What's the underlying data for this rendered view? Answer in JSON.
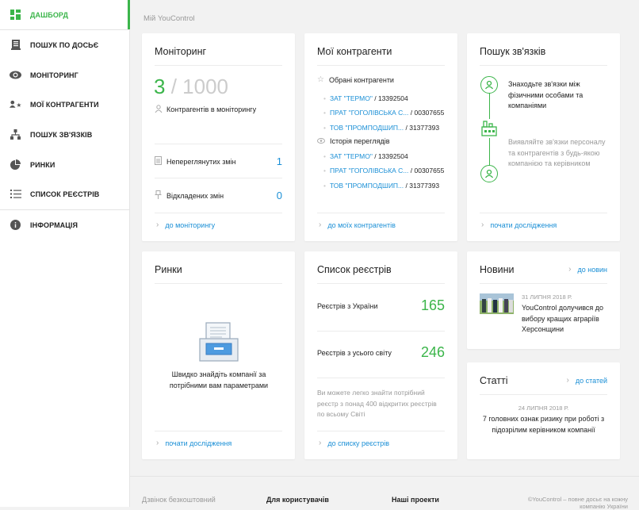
{
  "sidebar": {
    "items": [
      {
        "label": "ДАШБОРД",
        "icon": "dashboard-icon"
      },
      {
        "label": "ПОШУК ПО ДОСЬЄ",
        "icon": "dossier-icon"
      },
      {
        "label": "МОНІТОРИНГ",
        "icon": "eye-icon"
      },
      {
        "label": "МОЇ КОНТРАГЕНТИ",
        "icon": "contractors-icon"
      },
      {
        "label": "ПОШУК ЗВ'ЯЗКІВ",
        "icon": "relations-icon"
      },
      {
        "label": "РИНКИ",
        "icon": "pie-chart-icon"
      },
      {
        "label": "СПИСОК РЕЄСТРІВ",
        "icon": "list-icon"
      },
      {
        "label": "ІНФОРМАЦІЯ",
        "icon": "info-icon"
      }
    ]
  },
  "breadcrumb": "Мій YouControl",
  "monitoring": {
    "title": "Моніторинг",
    "count": "3",
    "limit": "/ 1000",
    "count_label": "Контрагентів в моніторингу",
    "unviewed_label": "Непереглянутих змін",
    "unviewed_value": "1",
    "postponed_label": "Відкладених змін",
    "postponed_value": "0",
    "link": "до моніторингу"
  },
  "contractors": {
    "title": "Мої контрагенти",
    "favorites_label": "Обрані контрагенти",
    "favorites": [
      {
        "name": "ЗАТ \"ТЕРМО\"",
        "code": "/ 13392504"
      },
      {
        "name": "ПРАТ \"ГОГОЛІВСЬКА С...",
        "code": "/ 00307655"
      },
      {
        "name": "ТОВ \"ПРОМПОДШИП...",
        "code": "/ 31377393"
      }
    ],
    "history_label": "Історія переглядів",
    "history": [
      {
        "name": "ЗАТ \"ТЕРМО\"",
        "code": "/ 13392504"
      },
      {
        "name": "ПРАТ \"ГОГОЛІВСЬКА С...",
        "code": "/ 00307655"
      },
      {
        "name": "ТОВ \"ПРОМПОДШИП...",
        "code": "/ 31377393"
      }
    ],
    "link": "до моїх контрагентів"
  },
  "relations": {
    "title": "Пошук зв'язків",
    "text1": "Знаходьте зв'язки між фізичними особами та компаніями",
    "text2": "Виявляйте зв'язки персоналу та контрагентів з будь-якою компанією та керівником",
    "link": "почати дослідження"
  },
  "markets": {
    "title": "Ринки",
    "text": "Швидко знайдіть компанії за потрібними вам параметрами",
    "link": "почати дослідження"
  },
  "registries": {
    "title": "Список реєстрів",
    "ua_label": "Реєстрів з України",
    "ua_value": "165",
    "world_label": "Реєстрів з усього світу",
    "world_value": "246",
    "note": "Ви можете легко знайти потрібний реєстр з понад 400 відкритих реєстрів по всьому Світі",
    "link": "до списку реєстрів"
  },
  "news": {
    "title": "Новини",
    "link": "до новин",
    "date": "31 ЛИПНЯ 2018 Р.",
    "text": "YouControl  долучився до вибору кращих аграріїв Херсонщини"
  },
  "articles": {
    "title": "Статті",
    "link": "до статей",
    "date": "24 ЛИПНЯ 2018 Р.",
    "text": "7 головних ознак ризику при роботі з підозрілим керівником компанії"
  },
  "footer": {
    "col1": "Дзвінок безкоштовний",
    "col2": "Для користувачів",
    "col3": "Наші проекти",
    "copyright": "©YouControl – повне досьє на кожну компанію України"
  },
  "colors": {
    "accent": "#3bb54a",
    "link": "#1a8fd6"
  }
}
